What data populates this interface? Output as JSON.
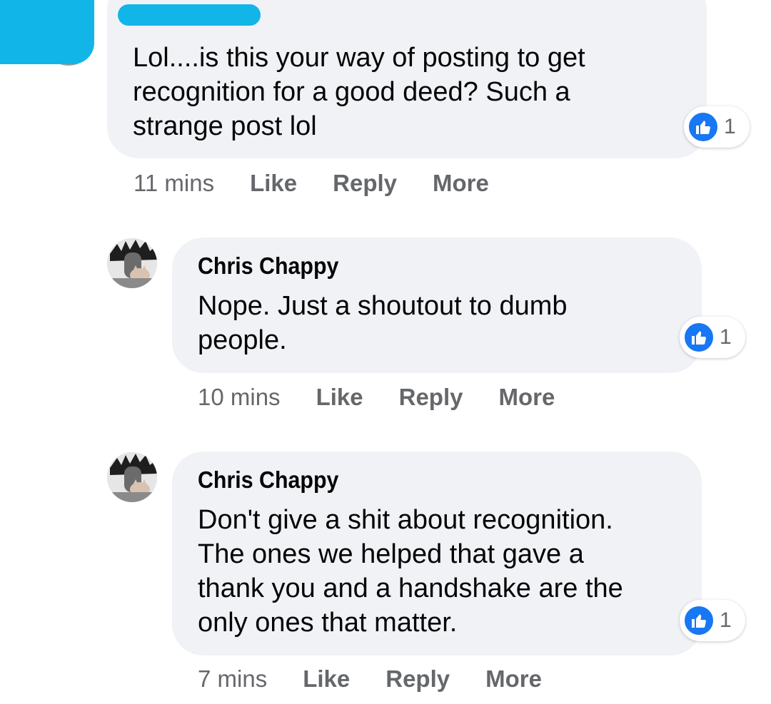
{
  "comments": [
    {
      "author": "",
      "author_redacted": true,
      "text": "Lol....is this your way of posting to get\nrecognition for a good deed? Such a\nstrange post lol",
      "reactions": "1",
      "time": "11 mins",
      "like": "Like",
      "reply": "Reply",
      "more": "More"
    },
    {
      "author": "Chris Chappy",
      "text": "Nope. Just a shoutout to dumb\npeople.",
      "reactions": "1",
      "time": "10 mins",
      "like": "Like",
      "reply": "Reply",
      "more": "More"
    },
    {
      "author": "Chris Chappy",
      "text": "Don't give a shit about recognition.\nThe ones we helped that gave a\nthank you and a handshake are the\nonly ones that matter.",
      "reactions": "1",
      "time": "7 mins",
      "like": "Like",
      "reply": "Reply",
      "more": "More"
    }
  ],
  "colors": {
    "bubble": "#f0f2f5",
    "like_blue": "#1877f2",
    "meta_gray": "#65676b",
    "redaction": "#12b5e8"
  },
  "icons": {
    "reaction": "thumbs-up-icon",
    "avatar": "profile-avatar"
  }
}
